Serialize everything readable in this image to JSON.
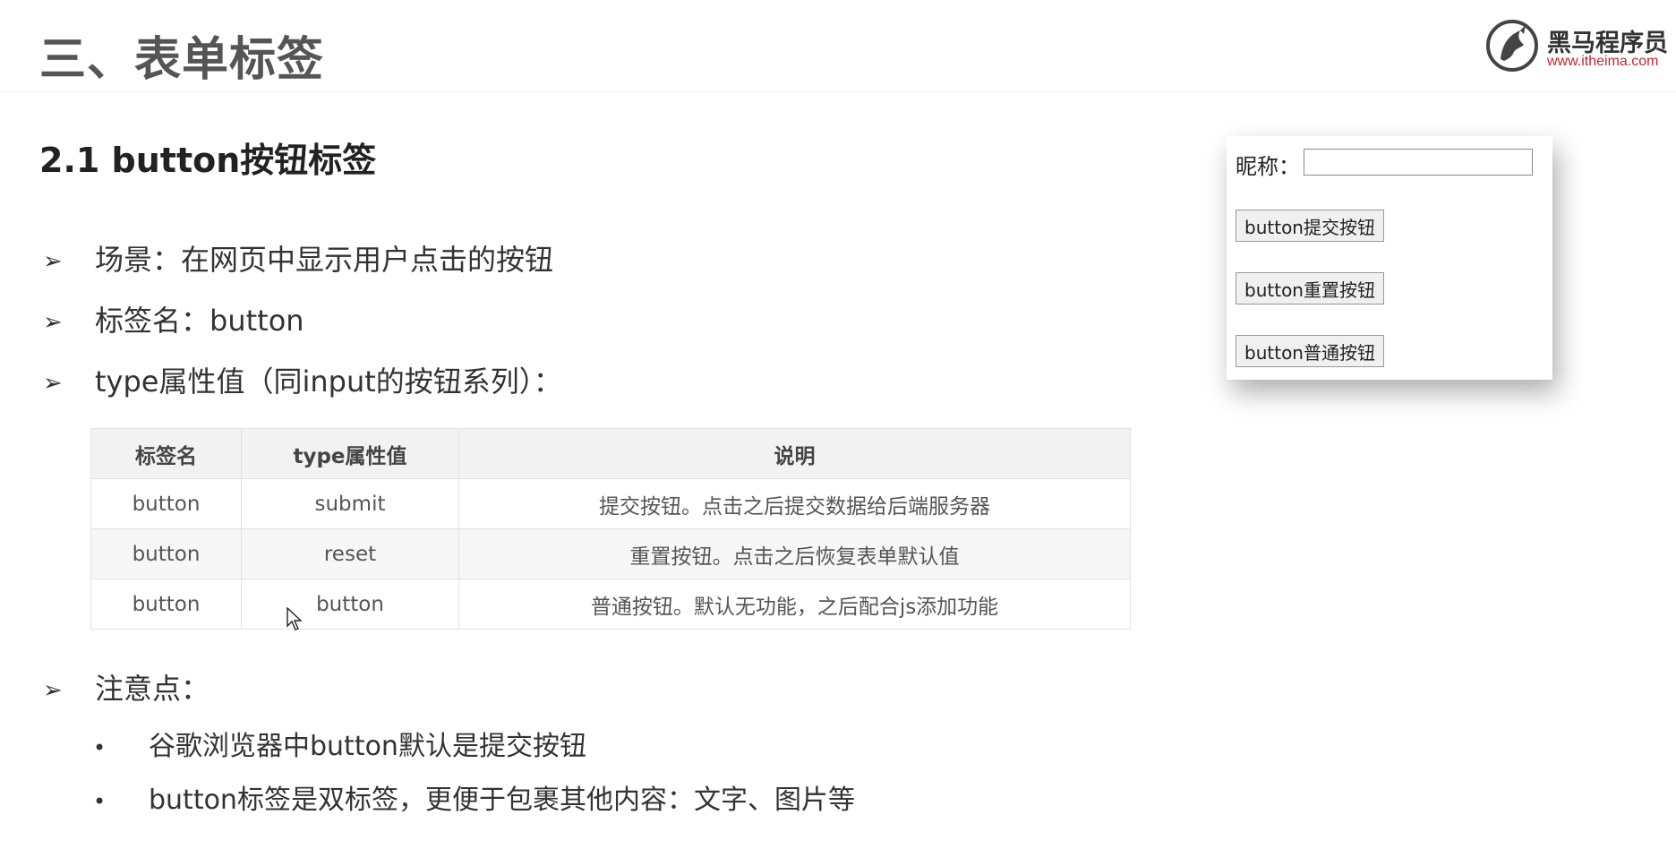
{
  "header": {
    "title": "三、表单标签",
    "logo_cn": "黑马程序员",
    "logo_url": "www.itheima.com"
  },
  "section": {
    "title": "2.1 button按钮标签"
  },
  "bullets": [
    "场景：在网页中显示用户点击的按钮",
    "标签名：button",
    "type属性值（同input的按钮系列）："
  ],
  "table": {
    "headers": [
      "标签名",
      "type属性值",
      "说明"
    ],
    "rows": [
      [
        "button",
        "submit",
        "提交按钮。点击之后提交数据给后端服务器"
      ],
      [
        "button",
        "reset",
        "重置按钮。点击之后恢复表单默认值"
      ],
      [
        "button",
        "button",
        "普通按钮。默认无功能，之后配合js添加功能"
      ]
    ]
  },
  "notes": {
    "title": "注意点：",
    "items": [
      "谷歌浏览器中button默认是提交按钮",
      "button标签是双标签，更便于包裹其他内容：文字、图片等"
    ]
  },
  "demo": {
    "label": "昵称：",
    "input_value": "",
    "buttons": [
      "button提交按钮",
      "button重置按钮",
      "button普通按钮"
    ]
  },
  "colors": {
    "logo_url": "#c1272d",
    "title": "#555555"
  },
  "icons": {
    "bullet": "arrowhead-bullet-icon",
    "cursor": "mouse-cursor-icon",
    "logo": "horse-logo-icon"
  }
}
